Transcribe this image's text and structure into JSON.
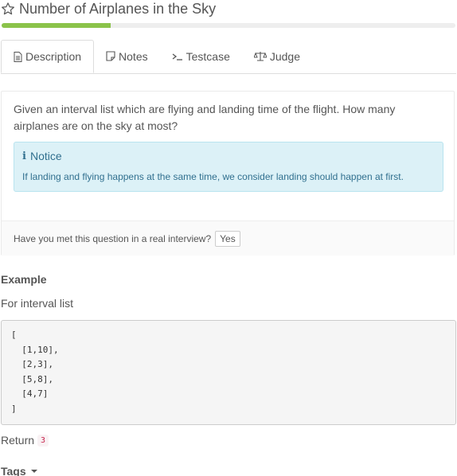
{
  "problem": {
    "title": "Number of Airplanes in the Sky",
    "progress": 0.24
  },
  "tabs": [
    {
      "label": "Description",
      "icon": "file-text-icon",
      "active": true
    },
    {
      "label": "Notes",
      "icon": "note-icon",
      "active": false
    },
    {
      "label": "Testcase",
      "icon": "terminal-icon",
      "active": false
    },
    {
      "label": "Judge",
      "icon": "balance-scale-icon",
      "active": false
    }
  ],
  "description": {
    "text": "Given an interval list which are flying and landing time of the flight. How many airplanes are on the sky at most?",
    "notice_title": "Notice",
    "notice_body": "If landing and flying happens at the same time, we consider landing should happen at first."
  },
  "interview": {
    "question": "Have you met this question in a real interview?",
    "yes_label": "Yes"
  },
  "example": {
    "heading": "Example",
    "intro": "For interval list",
    "code": "[\n  [1,10],\n  [2,3],\n  [5,8],\n  [4,7]\n]",
    "return_label": "Return",
    "return_value": "3"
  },
  "tags": {
    "label": "Tags"
  },
  "colors": {
    "progress": "#8bc34a",
    "notice_bg": "#dcf1f7",
    "notice_text": "#31708f"
  }
}
